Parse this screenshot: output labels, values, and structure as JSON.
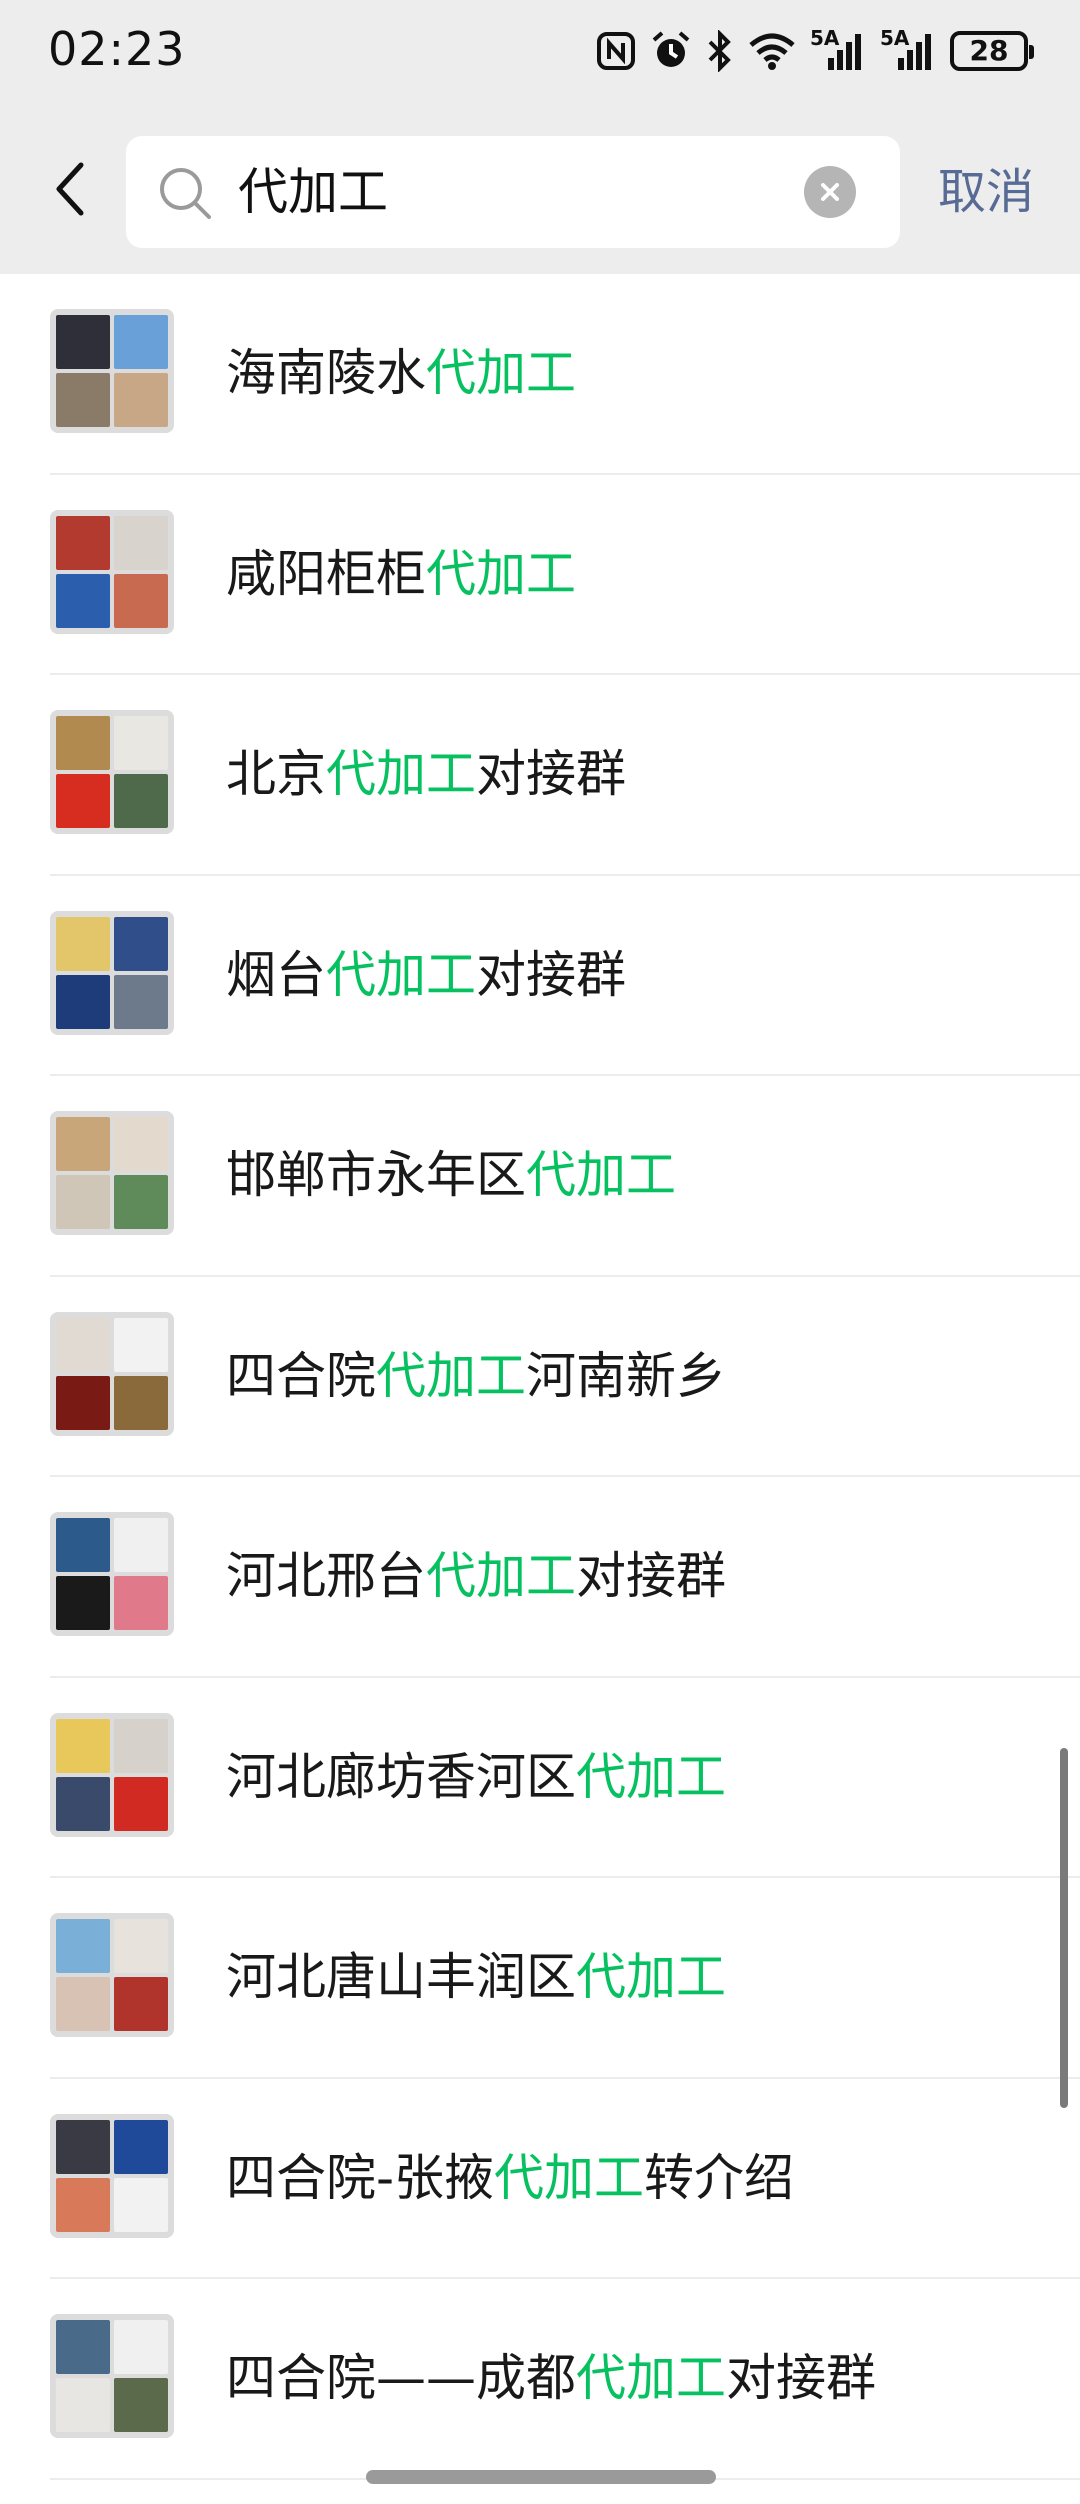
{
  "status_bar": {
    "time": "02:23",
    "battery": "28",
    "signal_labels": [
      "5A",
      "5A"
    ],
    "icons": [
      "nfc-icon",
      "alarm-icon",
      "bluetooth-icon",
      "wifi-icon",
      "signal-icon",
      "signal-icon",
      "battery-icon"
    ]
  },
  "search": {
    "query": "代加工",
    "cancel_label": "取消"
  },
  "colors": {
    "highlight": "#07c160",
    "link": "#576b95",
    "header_bg": "#ededed"
  },
  "results": [
    {
      "before": "海南陵水",
      "match": "代加工",
      "after": "",
      "tiles": 4,
      "avatar_colors": [
        "#2f2f3a",
        "#6aa0d8",
        "#8a7a68",
        "#c7a785"
      ]
    },
    {
      "before": "咸阳柜柜",
      "match": "代加工",
      "after": "",
      "tiles": 4,
      "avatar_colors": [
        "#b33a2e",
        "#d8d3cc",
        "#2b5fae",
        "#c76a4f"
      ]
    },
    {
      "before": "北京",
      "match": "代加工",
      "after": "对接群",
      "tiles": 4,
      "avatar_colors": [
        "#b08a4e",
        "#e9e7e2",
        "#d62d20",
        "#4e6a4b"
      ]
    },
    {
      "before": "烟台",
      "match": "代加工",
      "after": "对接群",
      "tiles": 4,
      "avatar_colors": [
        "#e4c66a",
        "#2f4e8a",
        "#1f3c7a",
        "#6c7a8c"
      ]
    },
    {
      "before": "邯郸市永年区",
      "match": "代加工",
      "after": "",
      "tiles": 4,
      "avatar_colors": [
        "#c9a67a",
        "#e3d9cc",
        "#cfc6b8",
        "#5f8a5a"
      ]
    },
    {
      "before": "四合院",
      "match": "代加工",
      "after": "河南新乡",
      "tiles": 4,
      "avatar_colors": [
        "#e0dad2",
        "#f2f2f2",
        "#7a1a14",
        "#8a6a3a"
      ]
    },
    {
      "before": "河北邢台",
      "match": "代加工",
      "after": "对接群",
      "tiles": 4,
      "avatar_colors": [
        "#2c5a8a",
        "#f0f0f0",
        "#1a1a1a",
        "#e07a8a"
      ]
    },
    {
      "before": "河北廊坊香河区",
      "match": "代加工",
      "after": "",
      "tiles": 4,
      "avatar_colors": [
        "#e8c85a",
        "#d6d1ca",
        "#3a4a6a",
        "#d02a22"
      ]
    },
    {
      "before": "河北唐山丰润区",
      "match": "代加工",
      "after": "",
      "tiles": 4,
      "avatar_colors": [
        "#7ab0d8",
        "#e8e2dc",
        "#d8c2b4",
        "#b0342c"
      ]
    },
    {
      "before": "四合院-张掖",
      "match": "代加工",
      "after": "转介绍",
      "tiles": 4,
      "avatar_colors": [
        "#3a3a44",
        "#1f4a9a",
        "#d87a5a",
        "#f2f2f2"
      ]
    },
    {
      "before": "四合院——成都",
      "match": "代加工",
      "after": "对接群",
      "tiles": 4,
      "avatar_colors": [
        "#4a6a8a",
        "#f0f0f0",
        "#e8e6e2",
        "#5a6a4a"
      ]
    }
  ]
}
